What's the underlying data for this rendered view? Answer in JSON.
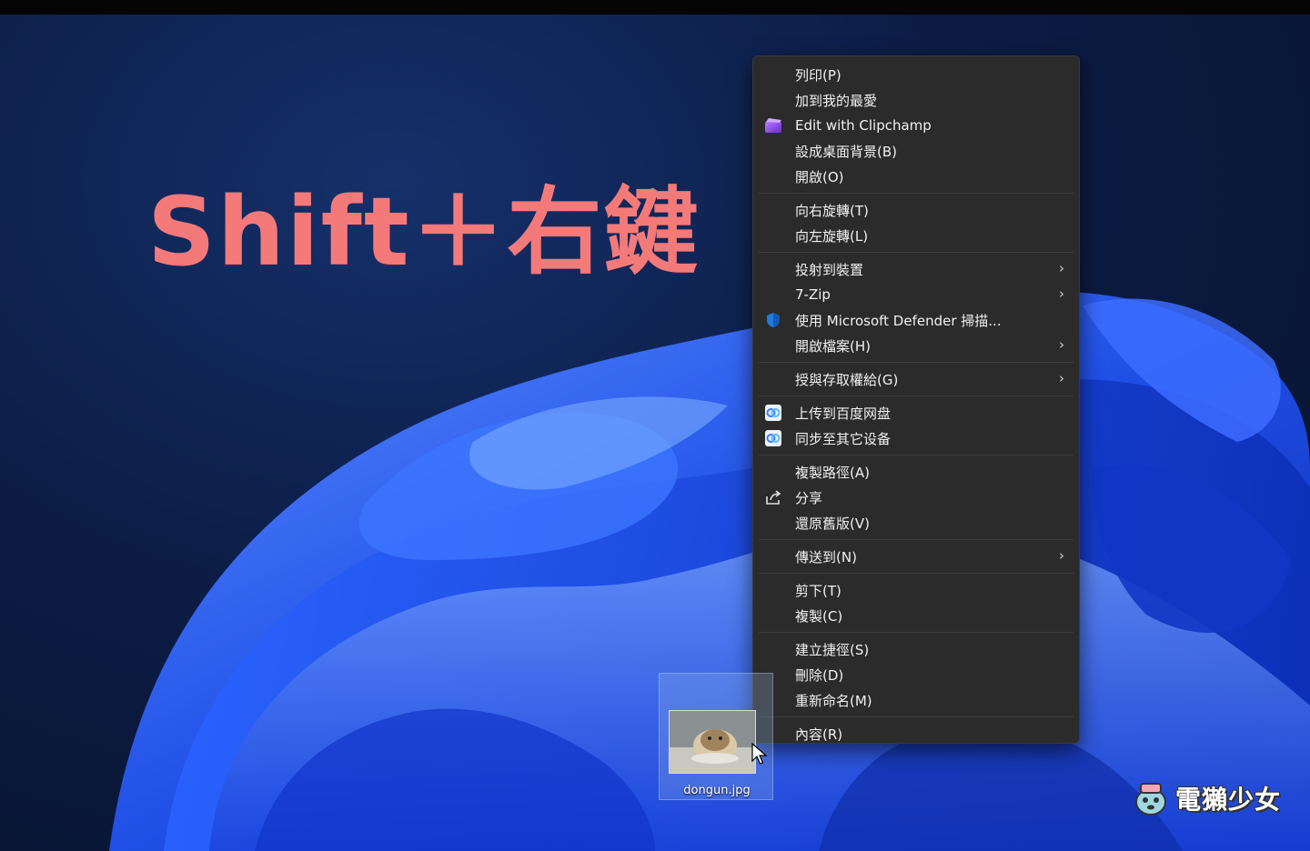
{
  "headline": "Shift＋右鍵",
  "menu": {
    "groups": [
      [
        {
          "label": "列印(P)",
          "icon": ""
        },
        {
          "label": "加到我的最愛",
          "icon": ""
        },
        {
          "label": "Edit with Clipchamp",
          "icon": "clipchamp-icon"
        },
        {
          "label": "設成桌面背景(B)",
          "icon": ""
        },
        {
          "label": "開啟(O)",
          "icon": ""
        }
      ],
      [
        {
          "label": "向右旋轉(T)",
          "icon": ""
        },
        {
          "label": "向左旋轉(L)",
          "icon": ""
        }
      ],
      [
        {
          "label": "投射到裝置",
          "icon": "",
          "submenu": true
        },
        {
          "label": "7-Zip",
          "icon": "",
          "submenu": true
        },
        {
          "label": "使用 Microsoft Defender 掃描...",
          "icon": "defender-shield-icon"
        },
        {
          "label": "開啟檔案(H)",
          "icon": "",
          "submenu": true
        }
      ],
      [
        {
          "label": "授與存取權給(G)",
          "icon": "",
          "submenu": true
        }
      ],
      [
        {
          "label": "上传到百度网盘",
          "icon": "baidu-netdisk-icon"
        },
        {
          "label": "同步至其它设备",
          "icon": "baidu-netdisk-icon"
        }
      ],
      [
        {
          "label": "複製路徑(A)",
          "icon": ""
        },
        {
          "label": "分享",
          "icon": "share-icon"
        },
        {
          "label": "還原舊版(V)",
          "icon": ""
        }
      ],
      [
        {
          "label": "傳送到(N)",
          "icon": "",
          "submenu": true
        }
      ],
      [
        {
          "label": "剪下(T)",
          "icon": ""
        },
        {
          "label": "複製(C)",
          "icon": ""
        }
      ],
      [
        {
          "label": "建立捷徑(S)",
          "icon": ""
        },
        {
          "label": "刪除(D)",
          "icon": ""
        },
        {
          "label": "重新命名(M)",
          "icon": ""
        }
      ],
      [
        {
          "label": "內容(R)",
          "icon": ""
        }
      ]
    ]
  },
  "file": {
    "name": "dongun.jpg"
  },
  "watermark": "電獺少女",
  "colors": {
    "headline": "#f47a7a",
    "menu_bg": "#2b2b2b",
    "accent_blue": "#1e5bff"
  }
}
